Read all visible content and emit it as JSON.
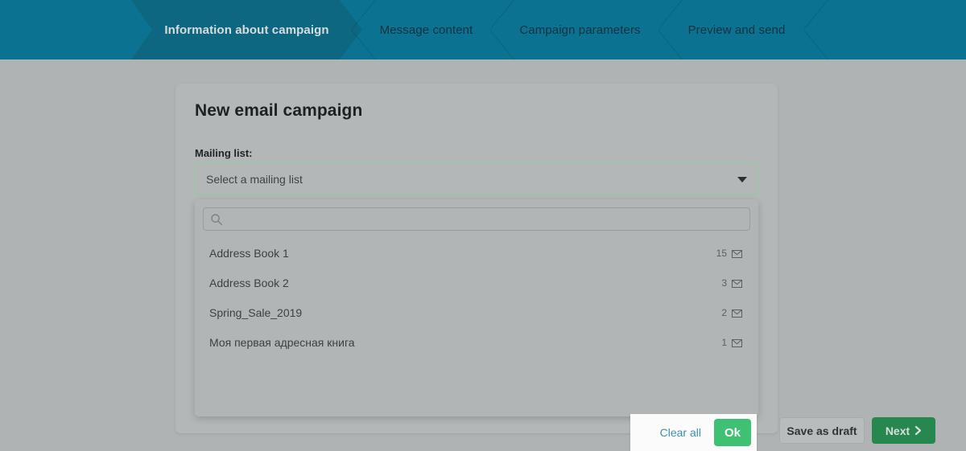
{
  "steps": {
    "tabs": [
      {
        "label": "Information about campaign",
        "active": true
      },
      {
        "label": "Message content",
        "active": false
      },
      {
        "label": "Campaign parameters",
        "active": false
      },
      {
        "label": "Preview and send",
        "active": false
      }
    ]
  },
  "card": {
    "title": "New email campaign",
    "mailing_list_label": "Mailing list:",
    "select": {
      "value": "Select a mailing list",
      "caret_icon": "chevron-down-icon"
    }
  },
  "dropdown": {
    "search": {
      "value": "",
      "placeholder": "",
      "icon": "search-icon"
    },
    "options": [
      {
        "name": "Address Book 1",
        "count": "15",
        "icon": "envelope-icon"
      },
      {
        "name": "Address Book 2",
        "count": "3",
        "icon": "envelope-icon"
      },
      {
        "name": "Spring_Sale_2019",
        "count": "2",
        "icon": "envelope-icon"
      },
      {
        "name": "Моя первая адресная книга",
        "count": "1",
        "icon": "envelope-icon"
      }
    ],
    "actions": {
      "clear_all": "Clear all",
      "ok": "Ok"
    }
  },
  "footer": {
    "save_draft": "Save as draft",
    "next": "Next",
    "next_icon": "chevron-right-icon"
  },
  "colors": {
    "header_bg": "#0b7391",
    "header_active_tab": "#0d6780",
    "page_bg": "#b0b3b3",
    "select_border": "#9fc1ae",
    "ok_green": "#3ec172",
    "next_green": "#26874f",
    "link_teal": "#3d93a8"
  }
}
